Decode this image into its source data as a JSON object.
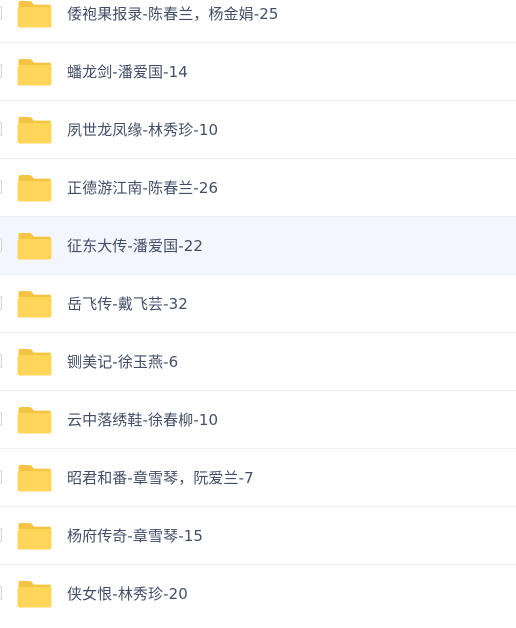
{
  "colors": {
    "folder": "#ffd659",
    "folder_tab": "#f5c443",
    "text": "#424e67",
    "divider": "#eef0f4",
    "row_hover": "#f3f7fd"
  },
  "files": [
    {
      "name": "倭袍果报录-陈春兰，杨金娟-25",
      "icon": "folder-icon"
    },
    {
      "name": "蟠龙剑-潘爱国-14",
      "icon": "folder-icon"
    },
    {
      "name": "夙世龙凤缘-林秀珍-10",
      "icon": "folder-icon"
    },
    {
      "name": "正德游江南-陈春兰-26",
      "icon": "folder-icon"
    },
    {
      "name": "征东大传-潘爱国-22",
      "icon": "folder-icon"
    },
    {
      "name": "岳飞传-戴飞芸-32",
      "icon": "folder-icon"
    },
    {
      "name": "铡美记-徐玉燕-6",
      "icon": "folder-icon"
    },
    {
      "name": "云中落绣鞋-徐春柳-10",
      "icon": "folder-icon"
    },
    {
      "name": "昭君和番-章雪琴，阮爱兰-7",
      "icon": "folder-icon"
    },
    {
      "name": "杨府传奇-章雪琴-15",
      "icon": "folder-icon"
    },
    {
      "name": "侠女恨-林秀珍-20",
      "icon": "folder-icon"
    }
  ]
}
